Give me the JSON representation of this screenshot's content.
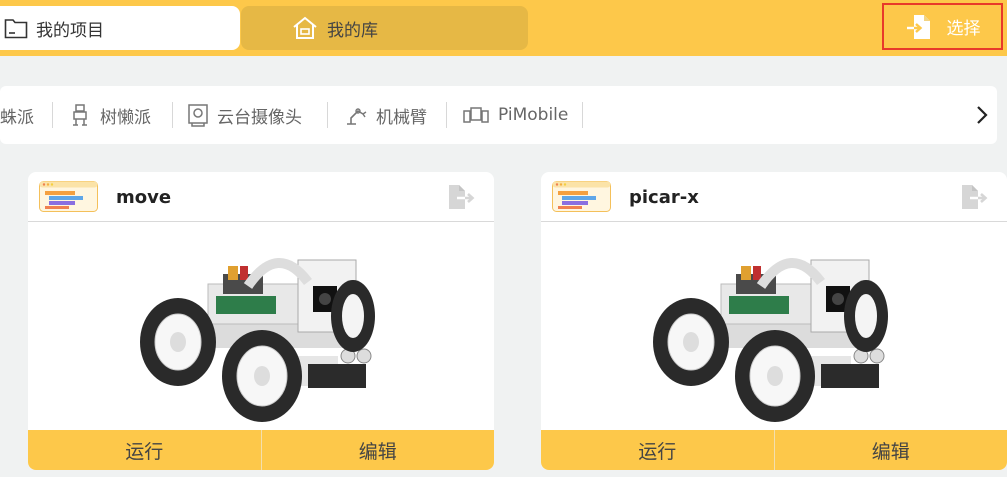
{
  "topbar": {
    "tabs": [
      {
        "label": "我的项目",
        "icon": "folder-icon",
        "active": true
      },
      {
        "label": "我的库",
        "icon": "home-icon",
        "active": false
      }
    ],
    "select_button": {
      "label": "选择",
      "icon": "import-file-icon"
    }
  },
  "categories": [
    {
      "label": "蛛派",
      "icon": ""
    },
    {
      "label": "树懒派",
      "icon": "robot-icon"
    },
    {
      "label": "云台摄像头",
      "icon": "camera-icon"
    },
    {
      "label": "机械臂",
      "icon": "robot-arm-icon"
    },
    {
      "label": "PiMobile",
      "icon": "mobile-robot-icon"
    }
  ],
  "cards": [
    {
      "title": "move",
      "run_label": "运行",
      "edit_label": "编辑",
      "image": "robot-car-image"
    },
    {
      "title": "picar-x",
      "run_label": "运行",
      "edit_label": "编辑",
      "image": "robot-car-image"
    }
  ],
  "colors": {
    "accent": "#fdc84a",
    "highlight_border": "#e83a2a",
    "background": "#f0f2f2"
  }
}
